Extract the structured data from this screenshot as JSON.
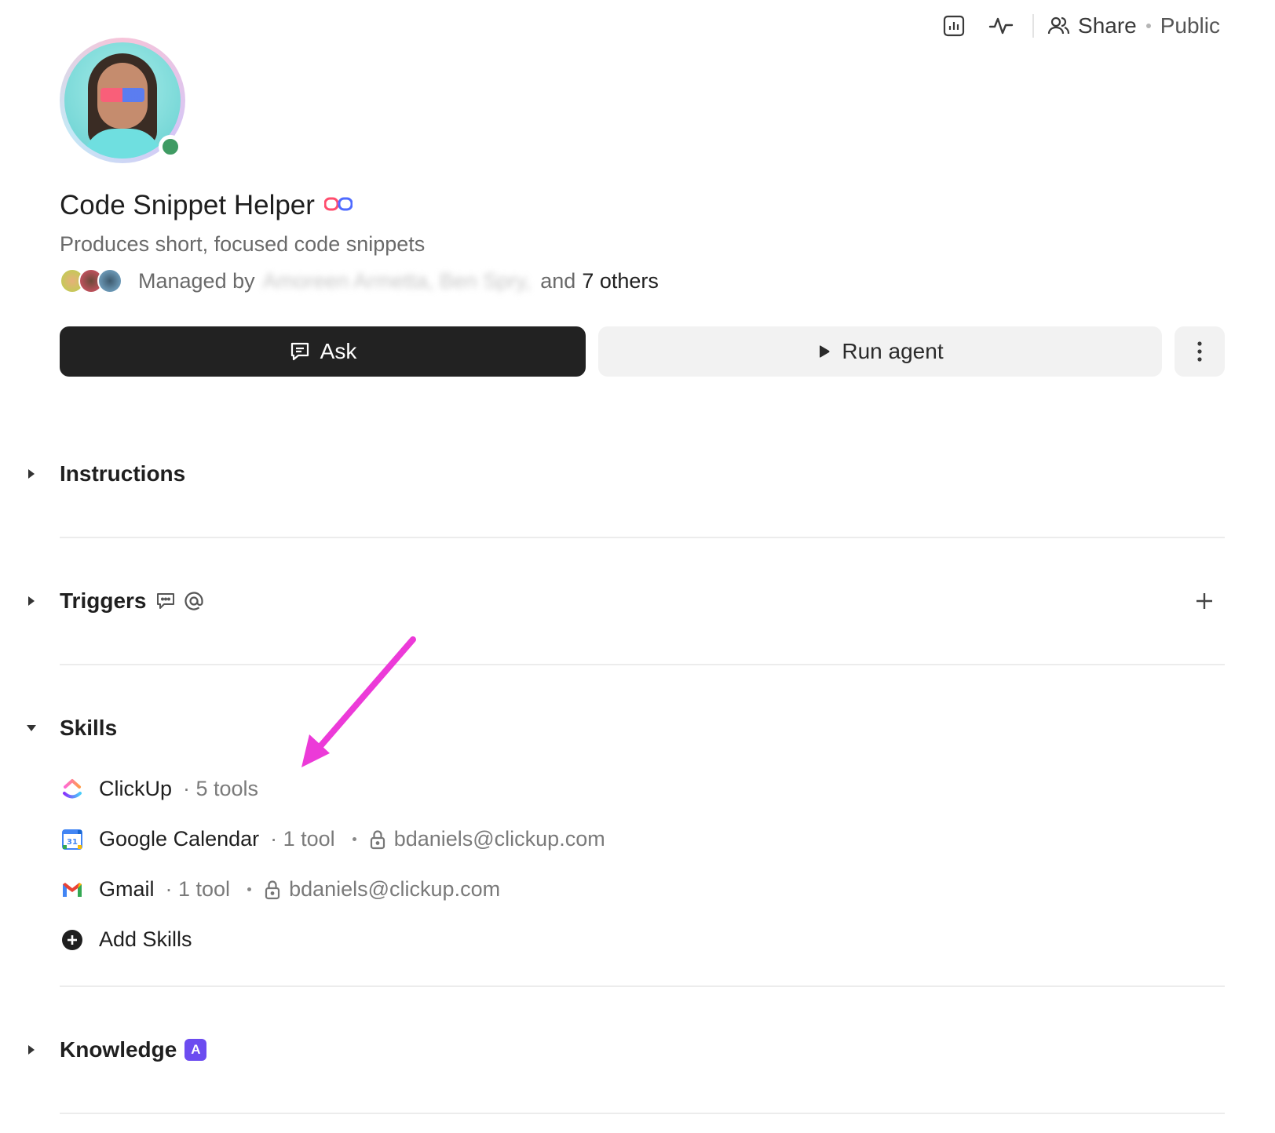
{
  "header": {
    "share_label": "Share",
    "visibility": "Public"
  },
  "agent": {
    "name": "Code Snippet Helper",
    "description": "Produces short, focused code snippets",
    "managed_label": "Managed by",
    "managers_blurred": "Amoreen Armetta, Ben Spry,",
    "and_label": "and",
    "others_label": "7 others"
  },
  "actions": {
    "ask_label": "Ask",
    "run_label": "Run agent"
  },
  "sections": {
    "instructions": "Instructions",
    "triggers": "Triggers",
    "skills": "Skills",
    "knowledge": "Knowledge",
    "knowledge_badge": "A"
  },
  "skills": [
    {
      "name": "ClickUp",
      "count": "· 5 tools"
    },
    {
      "name": "Google Calendar",
      "count": "· 1 tool",
      "account": "bdaniels@clickup.com"
    },
    {
      "name": "Gmail",
      "count": "· 1 tool",
      "account": "bdaniels@clickup.com"
    }
  ],
  "add_skills_label": "Add Skills",
  "colors": {
    "ask_bg": "#222222",
    "online": "#3f9b63",
    "knowledge_badge": "#6c4cf0",
    "annotation_arrow": "#ec3ad8"
  }
}
